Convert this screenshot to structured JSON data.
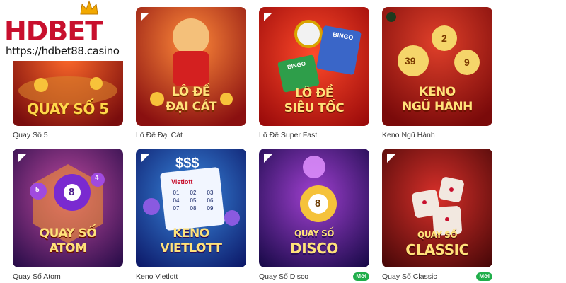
{
  "watermark": {
    "brand": "HDBET",
    "url": "https://hdbet88.casino"
  },
  "games": [
    {
      "name": "Quay Số 5",
      "art_title": [
        "QUAY SỐ 5"
      ],
      "new_badge": ""
    },
    {
      "name": "Lô Đề Đại Cát",
      "art_title": [
        "LÔ ĐỀ",
        "ĐẠI CÁT"
      ],
      "new_badge": ""
    },
    {
      "name": "Lô Đề Super Fast",
      "art_title": [
        "LÔ ĐỀ",
        "SIÊU TỐC"
      ],
      "art_extra": [
        "BINGO",
        "BINGO"
      ],
      "new_badge": ""
    },
    {
      "name": "Keno Ngũ Hành",
      "art_title": [
        "KENO",
        "NGŨ HÀNH"
      ],
      "balls": [
        "39",
        "2",
        "9"
      ],
      "new_badge": ""
    },
    {
      "name": "Quay Số Atom",
      "art_title": [
        "QUAY SỐ",
        "ATOM"
      ],
      "balls": [
        "8",
        "4",
        "5"
      ],
      "new_badge": ""
    },
    {
      "name": "Keno Vietlott",
      "art_title": [
        "KENO",
        "VIETLOTT"
      ],
      "art_extra": [
        "$$$",
        "Vietlott"
      ],
      "balls": [
        "01",
        "02",
        "03",
        "04",
        "05",
        "06",
        "07",
        "08",
        "09"
      ],
      "new_badge": ""
    },
    {
      "name": "Quay Số Disco",
      "art_title": [
        "QUAY SỐ",
        "DISCO"
      ],
      "balls": [
        "8"
      ],
      "new_badge": "Mới"
    },
    {
      "name": "Quay Số Classic",
      "art_title": [
        "QUAY SỐ",
        "CLASSIC"
      ],
      "new_badge": "Mới"
    }
  ],
  "colors": {
    "brand_red": "#c8102e",
    "new_badge": "#1fae4a"
  },
  "icons": {
    "provider": "provider-logo-icon",
    "crown": "crown-icon"
  }
}
